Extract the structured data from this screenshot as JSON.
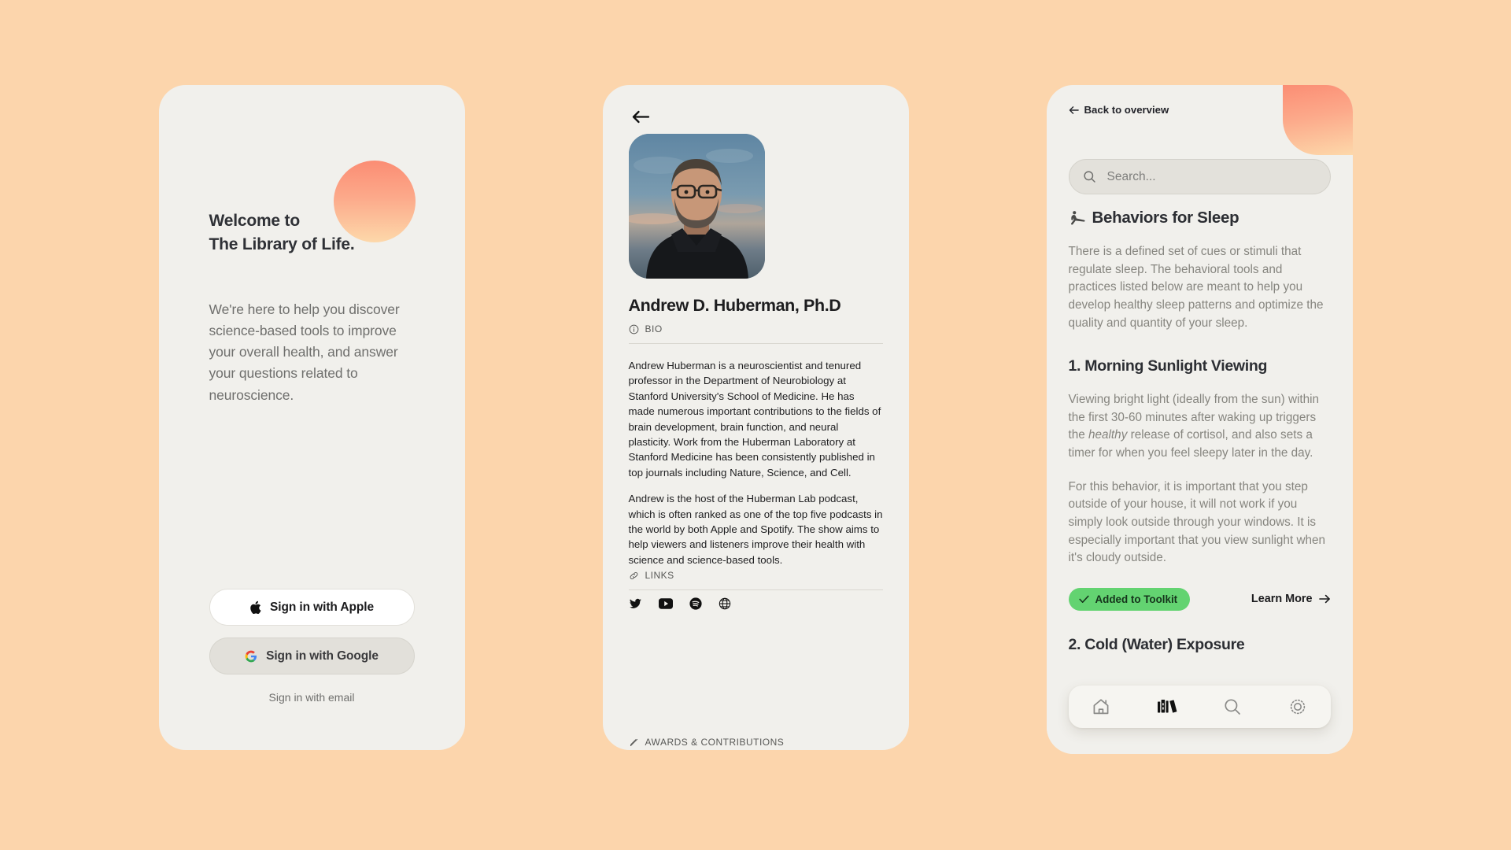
{
  "theme": {
    "background": "#FCD5AC",
    "card": "#F1F0EC",
    "accent_top": "#FB8D74",
    "accent_bottom": "#FDD8AA",
    "green": "#63D371"
  },
  "panel_welcome": {
    "heading_line1": "Welcome to",
    "heading_line2": "The Library of Life.",
    "body": "We're here to help you discover science-based tools to improve your overall health, and answer your questions related to neuroscience.",
    "apple_button": "Sign in with Apple",
    "google_button": "Sign in with Google",
    "email_link": "Sign in with email",
    "icons": {
      "apple": "apple-icon",
      "google": "google-icon",
      "blob": "gradient-circle"
    }
  },
  "panel_profile": {
    "back_icon": "back-arrow-icon",
    "name": "Andrew D. Huberman, Ph.D",
    "bio_label": "BIO",
    "bio_icon": "info-icon",
    "bio_paragraph_1": "Andrew Huberman is a neuroscientist and tenured professor in the Department of Neurobiology at Stanford University's School of Medicine. He has made numerous important contributions to the fields of brain development, brain function, and neural plasticity. Work from the Huberman Laboratory at Stanford Medicine has been consistently published in top journals including Nature, Science, and Cell.",
    "bio_paragraph_2": "Andrew is the host of the Huberman Lab podcast, which is often ranked as one of the top five podcasts in the world by both Apple and Spotify. The show aims to help viewers and listeners improve their health with science and science-based tools.",
    "links_label": "LINKS",
    "links_icon": "link-icon",
    "social": [
      {
        "name": "twitter-icon",
        "label": "Twitter"
      },
      {
        "name": "youtube-icon",
        "label": "YouTube"
      },
      {
        "name": "spotify-icon",
        "label": "Spotify"
      },
      {
        "name": "website-icon",
        "label": "Website"
      }
    ],
    "awards_label": "AWARDS & CONTRIBUTIONS",
    "awards_icon": "pencil-icon"
  },
  "panel_behaviors": {
    "back_label": "Back to overview",
    "back_icon": "arrow-left-icon",
    "search": {
      "placeholder": "Search...",
      "value": "",
      "icon": "search-icon"
    },
    "section_title": "Behaviors for Sleep",
    "section_icon": "stretching-person-icon",
    "section_intro": "There is a defined set of cues or stimuli that regulate sleep. The behavioral tools and practices listed below are meant to help you develop healthy sleep patterns and optimize the quality and quantity of your sleep.",
    "item_1": {
      "title": "1. Morning Sunlight Viewing",
      "para_1_before": "Viewing bright light (ideally from the sun) within the first 30-60 minutes after waking up triggers the ",
      "para_1_italic": "healthy",
      "para_1_after": " release of cortisol, and also sets a timer for when you feel sleepy later in the day.",
      "para_2": "For this behavior, it is important that you step outside of your house, it will not work if you simply look outside through your windows. It is especially important that you view sunlight when it's cloudy outside.",
      "added_label": "Added to Toolkit",
      "added_icon": "check-icon",
      "learn_more_label": "Learn More",
      "learn_more_icon": "arrow-right-icon"
    },
    "item_2": {
      "title": "2. Cold (Water) Exposure"
    },
    "bottom_nav": [
      {
        "name": "nav-home",
        "icon": "home-icon",
        "active": false
      },
      {
        "name": "nav-library",
        "icon": "books-icon",
        "active": true
      },
      {
        "name": "nav-search",
        "icon": "search-icon",
        "active": false
      },
      {
        "name": "nav-brightness",
        "icon": "sun-icon",
        "active": false
      }
    ]
  }
}
